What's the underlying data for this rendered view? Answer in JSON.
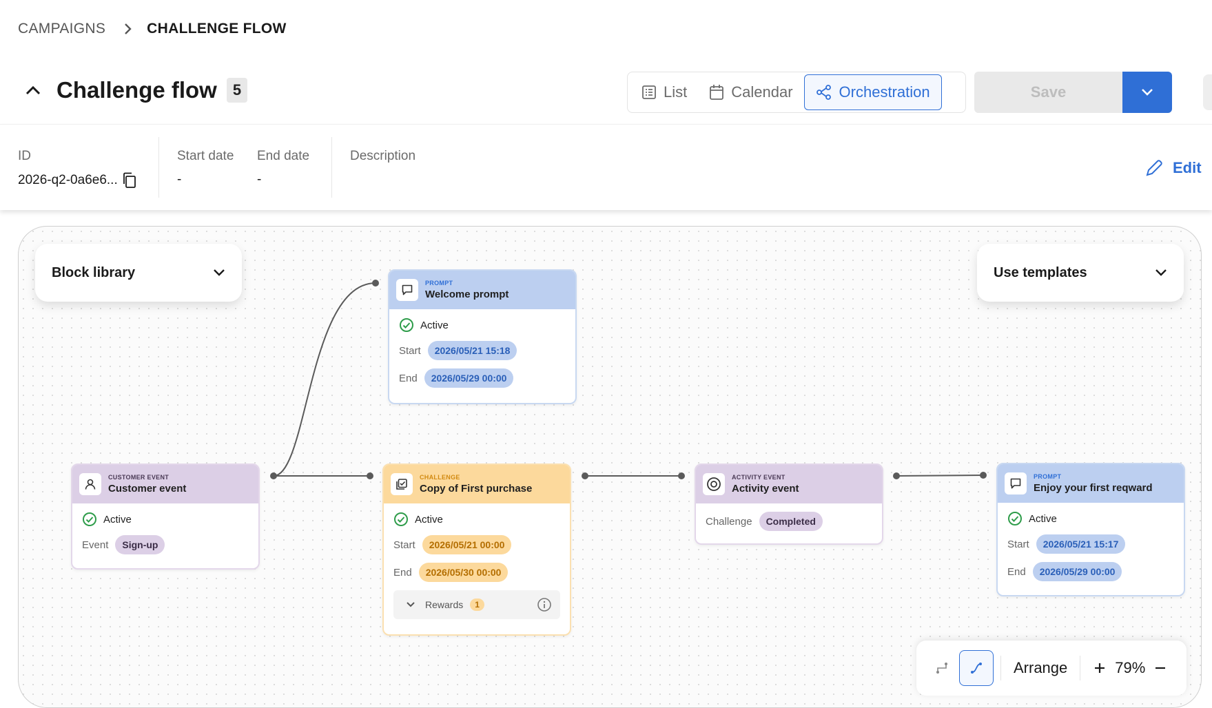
{
  "breadcrumb": {
    "parent": "CAMPAIGNS",
    "current": "CHALLENGE FLOW"
  },
  "header": {
    "title": "Challenge flow",
    "count": "5"
  },
  "view_switch": {
    "list": "List",
    "calendar": "Calendar",
    "orchestration": "Orchestration",
    "active": "orchestration"
  },
  "actions": {
    "save": "Save",
    "edit": "Edit"
  },
  "meta": {
    "id_label": "ID",
    "id_value": "2026-q2-0a6e6...",
    "start_label": "Start date",
    "start_value": "-",
    "end_label": "End date",
    "end_value": "-",
    "description_label": "Description"
  },
  "canvas": {
    "block_library": "Block library",
    "use_templates": "Use templates",
    "nodes": {
      "customer_event": {
        "kind": "Customer event",
        "name": "Customer event",
        "status": "Active",
        "event_label": "Event",
        "event_value": "Sign-up"
      },
      "welcome_prompt": {
        "kind": "Prompt",
        "name": "Welcome prompt",
        "status": "Active",
        "start_label": "Start",
        "start_value": "2026/05/21 15:18",
        "end_label": "End",
        "end_value": "2026/05/29 00:00"
      },
      "challenge": {
        "kind": "Challenge",
        "name": "Copy of First purchase",
        "status": "Active",
        "start_label": "Start",
        "start_value": "2026/05/21 00:00",
        "end_label": "End",
        "end_value": "2026/05/30 00:00",
        "rewards_label": "Rewards",
        "rewards_count": "1"
      },
      "activity_event": {
        "kind": "Activity event",
        "name": "Activity event",
        "challenge_label": "Challenge",
        "challenge_value": "Completed"
      },
      "reward_prompt": {
        "kind": "Prompt",
        "name": "Enjoy your first reqward",
        "status": "Active",
        "start_label": "Start",
        "start_value": "2026/05/21 15:17",
        "end_label": "End",
        "end_value": "2026/05/29 00:00"
      }
    }
  },
  "toolbar": {
    "arrange": "Arrange",
    "zoom": "79%"
  },
  "colors": {
    "accent": "#2f6fd6",
    "purple": "#dccfe6",
    "blue": "#bccff0",
    "orange": "#fcd99c",
    "success": "#2e9c4a"
  },
  "icons": [
    "chevron-right-icon",
    "chevron-up-icon",
    "list-icon",
    "calendar-icon",
    "orchestration-icon",
    "chevron-down-icon",
    "copy-icon",
    "pencil-icon",
    "user-icon",
    "message-icon",
    "checklist-icon",
    "target-icon",
    "check-circle-icon",
    "info-icon",
    "plus-icon",
    "minus-icon"
  ]
}
